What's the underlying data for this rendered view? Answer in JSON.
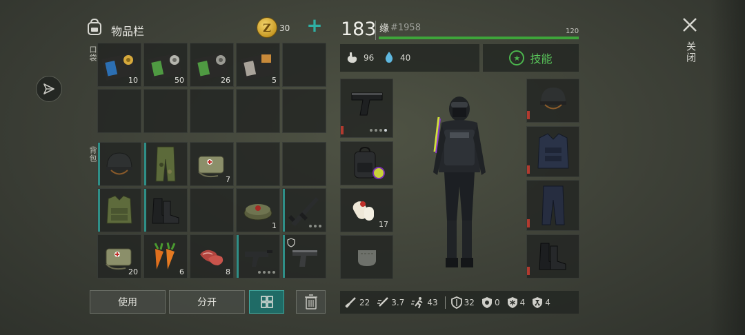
{
  "header": {
    "inventory_title": "物品栏",
    "coin_symbol": "Z",
    "coin_count": "30",
    "coin_plus": "+"
  },
  "sections": {
    "pockets_label": "口袋",
    "backpack_label": "背包"
  },
  "pocket_items": [
    {
      "name": "blue-id-card-icon",
      "count": "10"
    },
    {
      "name": "green-id-card-icon",
      "count": "50"
    },
    {
      "name": "green-id-card-icon",
      "count": "26"
    },
    {
      "name": "dark-id-card-icon",
      "count": "5"
    }
  ],
  "backpack_items": [
    {
      "name": "helmet-icon",
      "count": ""
    },
    {
      "name": "camo-pants-icon",
      "count": ""
    },
    {
      "name": "medkit-bag-icon",
      "count": "7"
    },
    {
      "name": "camo-vest-icon",
      "count": ""
    },
    {
      "name": "boots-icon",
      "count": ""
    },
    {
      "name": "landmine-icon",
      "count": "1"
    },
    {
      "name": "assault-rifle-icon",
      "count": ""
    },
    {
      "name": "medkit-bag-icon",
      "count": "20"
    },
    {
      "name": "carrot-icon",
      "count": "6"
    },
    {
      "name": "raw-meat-icon",
      "count": "8"
    },
    {
      "name": "uzi-icon",
      "count": ""
    },
    {
      "name": "desert-eagle-icon",
      "count": ""
    }
  ],
  "buttons": {
    "use": "使用",
    "split": "分开"
  },
  "player": {
    "level": "183",
    "name": "缘",
    "id": "#1958",
    "xp_value": "120",
    "xp_fraction": 1.0,
    "hunger": "96",
    "thirst": "40",
    "skills_label": "技能",
    "skills_icon": "★"
  },
  "equipment": {
    "weapon_icon": "pistol-icon",
    "backpack_icon": "tactical-backpack-icon",
    "bandage_count": "17",
    "pocket_icon": "empty-pocket-icon",
    "head_icon": "helmet-icon",
    "body_icon": "police-vest-icon",
    "legs_icon": "police-pants-icon",
    "feet_icon": "boots-icon"
  },
  "stats": {
    "damage": "22",
    "attack_speed": "3.7",
    "move_speed": "43",
    "armor": "32",
    "bio_resist": "0",
    "cold_resist": "4",
    "radiation_resist": "4"
  },
  "close_label": "关闭",
  "colors": {
    "accent_teal": "#2f8f87",
    "xp_green": "#3ea53a",
    "skill_green": "#59c55a",
    "durability_red": "#b23a2f",
    "coin_gold": "#e0b840"
  }
}
